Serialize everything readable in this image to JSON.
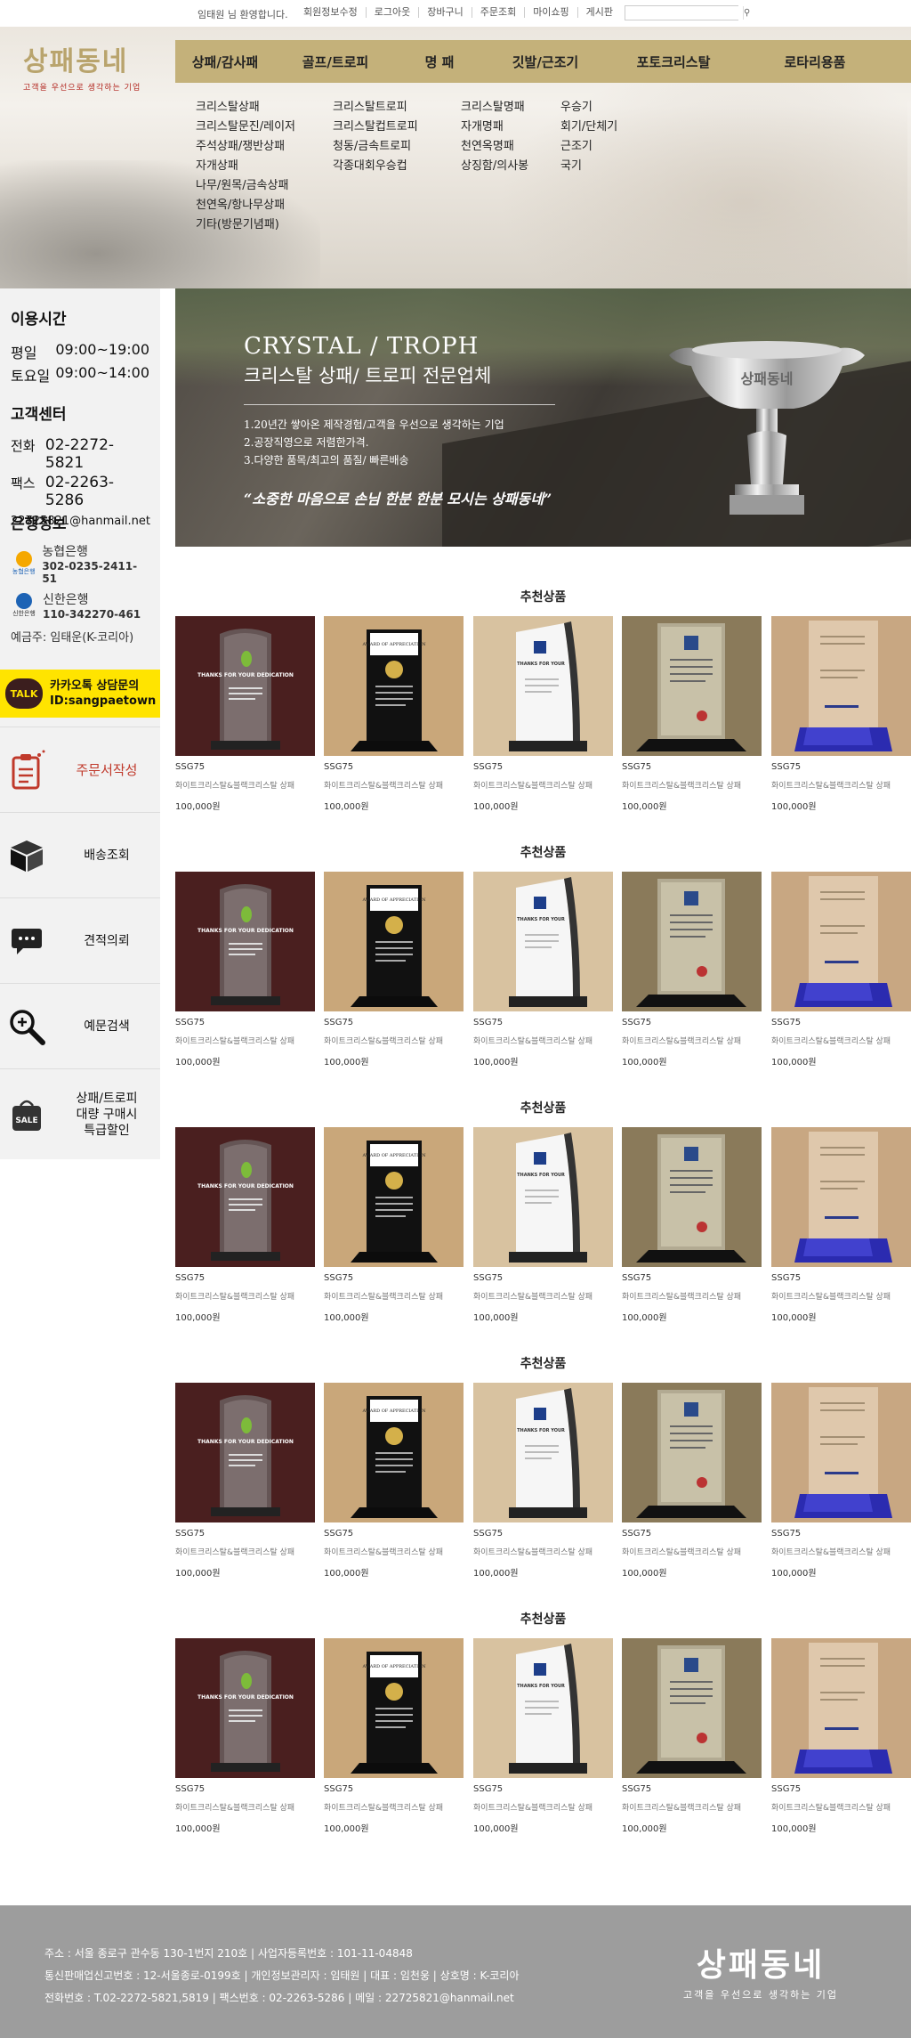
{
  "topbar": {
    "welcome": "임태원 님 환영합니다.",
    "links": [
      "회원정보수정",
      "로그아웃",
      "장바구니",
      "주문조회",
      "마이쇼핑",
      "게시판"
    ]
  },
  "brand": {
    "name": "상패동네",
    "tagline": "고객을 우선으로 생각하는 기업"
  },
  "gnb": [
    "상패/감사패",
    "골프/트로피",
    "명  패",
    "깃발/근조기",
    "포토크리스탈",
    "로타리용품"
  ],
  "submenu": [
    [
      "크리스탈상패",
      "크리스탈문진/레이저",
      "주석상패/쟁반상패",
      "자개상패",
      "나무/원목/금속상패",
      "천연옥/항나무상패",
      "기타(방문기념패)"
    ],
    [
      "크리스탈트로피",
      "크리스탈컵트로피",
      "청동/금속트로피",
      "각종대회우승컵"
    ],
    [
      "크리스탈명패",
      "자개명패",
      "천연옥명패",
      "상징함/의사봉"
    ],
    [
      "우승기",
      "회기/단체기",
      "근조기",
      "국기"
    ]
  ],
  "sidebar": {
    "hours_title": "이용시간",
    "hours": [
      {
        "day": "평일",
        "time": "09:00~19:00"
      },
      {
        "day": "토요일",
        "time": "09:00~14:00"
      }
    ],
    "cs_title": "고객센터",
    "phone_label": "전화",
    "phone": "02-2272-5821",
    "fax_label": "팩스",
    "fax": "02-2263-5286",
    "email": "22725821@hanmail.net",
    "bank_title": "은행정보",
    "banks": [
      {
        "name": "농협은행",
        "account": "302-0235-2411-51",
        "icon": "nh-bank-icon",
        "icon_label": "농협은행",
        "color": "#f5a800"
      },
      {
        "name": "신한은행",
        "account": "110-342270-461",
        "icon": "shinhan-bank-icon",
        "icon_label": "신한은행",
        "color": "#1d63b5"
      }
    ],
    "depositor": "예금주: 임태운(K-코리아)",
    "kakao": {
      "badge": "TALK",
      "line1": "카카오톡 상담문의",
      "line2": "ID:sangpaetown"
    },
    "quick": [
      {
        "label": "주문서작성",
        "icon": "order-form-icon",
        "color": "#c0392b"
      },
      {
        "label": "배송조회",
        "icon": "delivery-box-icon",
        "color": "#111"
      },
      {
        "label": "견적의뢰",
        "icon": "speech-bubble-icon",
        "color": "#111"
      },
      {
        "label": "예문검색",
        "icon": "magnifier-icon",
        "color": "#111"
      },
      {
        "label": "상패/트로피\n대량 구매시\n특급할인",
        "icon": "sale-bag-icon",
        "color": "#111"
      }
    ]
  },
  "banner": {
    "title_en": "CRYSTAL / TROPH",
    "title_ko": "크리스탈 상패/ 트로피 전문업체",
    "points": [
      "1.20년간 쌓아온 제작경험/고객을 우선으로 생각하는 기업",
      "2.공장직영으로 저렴한가격.",
      "3.다양한 품목/최고의 품질/ 빠른배송"
    ],
    "quote": "“소중한 마음으로 손님 한분 한분 모시는 상패동네”",
    "cup_text": "상패동네"
  },
  "sections": [
    {
      "title": "추천상품"
    },
    {
      "title": "추천상품"
    },
    {
      "title": "추천상품"
    },
    {
      "title": "추천상품"
    },
    {
      "title": "추천상품"
    }
  ],
  "product": {
    "code": "SSG75",
    "name": "화이트크리스탈&블랙크리스탈 상패",
    "price": "100,000원"
  },
  "product_images": [
    {
      "caption": "THANKS FOR YOUR DEDICATION",
      "bg": "#4a1f1f"
    },
    {
      "caption": "AWARD OF APPRECIATION",
      "bg": "#c9a77a"
    },
    {
      "caption": "THANKS FOR YOUR",
      "bg": "#d8c2a0"
    },
    {
      "caption": "",
      "bg": "#8a7a5a"
    },
    {
      "caption": "",
      "bg": "#c8a782"
    }
  ],
  "footer": {
    "lines": [
      "주소 : 서울 종로구 관수동 130-1번지 210호  |  사업자등록번호 : 101-11-04848",
      "통신판매업신고번호 : 12-서울종로-0199호  |  개인정보관리자 : 임태원  |  대표 : 임천웅  |  상호명 : K-코리아",
      "전화번호 : T.02-2272-5821,5819  |  팩스번호 : 02-2263-5286  |  메일 : 22725821@hanmail.net"
    ]
  }
}
